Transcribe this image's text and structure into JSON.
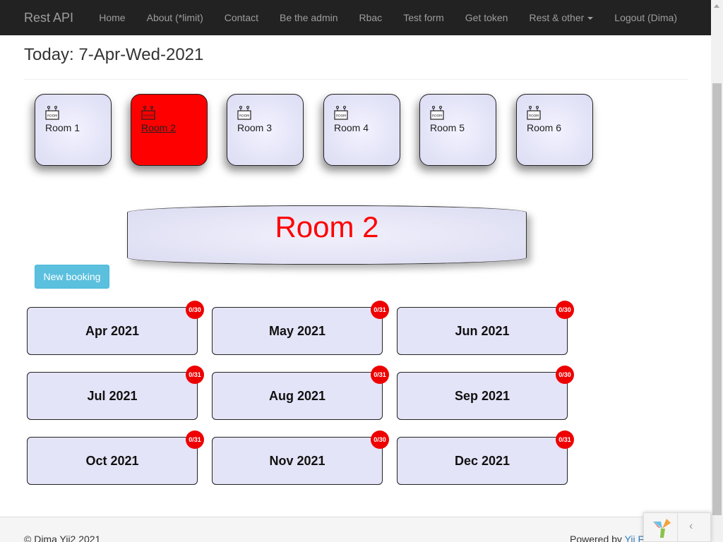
{
  "navbar": {
    "brand": "Rest API",
    "items": [
      {
        "label": "Home"
      },
      {
        "label": "About (*limit)"
      },
      {
        "label": "Contact"
      },
      {
        "label": "Be the admin"
      },
      {
        "label": "Rbac"
      },
      {
        "label": "Test form"
      },
      {
        "label": "Get token"
      },
      {
        "label": "Rest & other"
      },
      {
        "label": "Logout (Dima)"
      }
    ]
  },
  "page": {
    "title": "Today: 7-Apr-Wed-2021"
  },
  "rooms": [
    {
      "label": "Room 1",
      "icon": "room-sign-icon"
    },
    {
      "label": "Room 2",
      "icon": "room-sign-icon",
      "active": true
    },
    {
      "label": "Room 3",
      "icon": "room-sign-icon"
    },
    {
      "label": "Room 4",
      "icon": "room-sign-icon"
    },
    {
      "label": "Room 5",
      "icon": "room-sign-icon"
    },
    {
      "label": "Room 6",
      "icon": "room-sign-icon"
    }
  ],
  "room_icon_text": "ROOM",
  "selected_room": {
    "title": "Room 2",
    "color": "#ff0000"
  },
  "actions": {
    "new_booking": "New booking"
  },
  "months": [
    {
      "name": "Apr 2021",
      "badge": "0/30"
    },
    {
      "name": "May 2021",
      "badge": "0/31"
    },
    {
      "name": "Jun 2021",
      "badge": "0/30"
    },
    {
      "name": "Jul 2021",
      "badge": "0/31"
    },
    {
      "name": "Aug 2021",
      "badge": "0/31"
    },
    {
      "name": "Sep 2021",
      "badge": "0/30"
    },
    {
      "name": "Oct 2021",
      "badge": "0/31"
    },
    {
      "name": "Nov 2021",
      "badge": "0/30"
    },
    {
      "name": "Dec 2021",
      "badge": "0/31"
    }
  ],
  "footer": {
    "copyright": "© Dima Yii2 2021",
    "powered_by": "Powered by ",
    "powered_link": "Yii F"
  },
  "colors": {
    "navbar": "#222222",
    "active_room": "#ff0000",
    "badge": "#ee0000",
    "button": "#5bc0de"
  }
}
